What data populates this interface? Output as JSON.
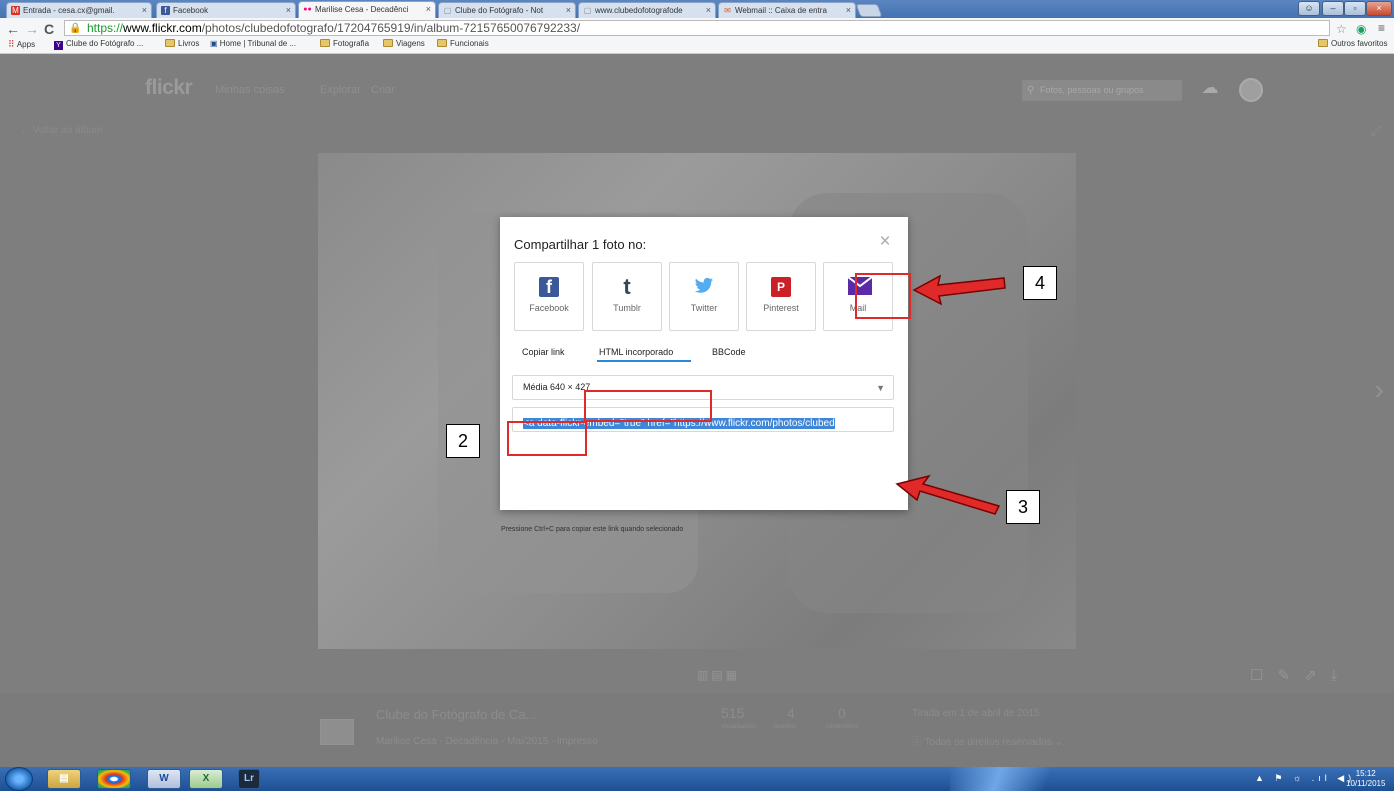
{
  "browser": {
    "tabs": [
      {
        "label": "Entrada - cesa.cx@gmail.",
        "icon": "M",
        "color": "#d93025"
      },
      {
        "label": "Facebook",
        "icon": "f",
        "color": "#3b5998"
      },
      {
        "label": "Marilise Cesa - Decadênci",
        "icon": "●●",
        "color": "#ff0084"
      },
      {
        "label": "Clube do Fotógrafo - Not",
        "icon": "▢",
        "color": "#888888"
      },
      {
        "label": "www.clubedofotografode",
        "icon": "▢",
        "color": "#888888"
      },
      {
        "label": "Webmail :: Caixa de entra",
        "icon": "✉",
        "color": "#d85a2a"
      }
    ],
    "url_scheme": "https://",
    "url_domain": "www.flickr.com",
    "url_path": "/photos/clubedofotografo/17204765919/in/album-72157650076792233/",
    "bookmarks": [
      "Apps",
      "Clube do Fotógrafo ...",
      "Livros",
      "Home | Tribunal de ...",
      "Fotografia",
      "Viagens",
      "Funcionais"
    ],
    "other_bookmarks": "Outros favoritos"
  },
  "flickr": {
    "logo": "flickr",
    "nav": [
      "Minhas coisas",
      "Explorar",
      "Criar"
    ],
    "search_placeholder": "Fotos, pessoas ou grupos",
    "back_label": "Voltar ao álbum"
  },
  "share_dialog": {
    "title": "Compartilhar 1 foto no:",
    "close": "×",
    "services": [
      {
        "label": "Facebook",
        "icon": "f",
        "color": "#3b5998"
      },
      {
        "label": "Tumblr",
        "icon": "t",
        "color": "#35465c"
      },
      {
        "label": "Twitter",
        "icon": "🐦",
        "color": "#55acee"
      },
      {
        "label": "Pinterest",
        "icon": "P",
        "color": "#cb2027"
      },
      {
        "label": "Mail",
        "icon": "✉",
        "color": "#6a1b9a"
      }
    ],
    "tabs": [
      "Copiar link",
      "HTML incorporado",
      "BBCode"
    ],
    "active_tab": "HTML incorporado",
    "size_value": "Média 640 × 427",
    "embed_code": "<a data-flickr-embed=\"true\"  href=\"https://www.flickr.com/photos/clubed",
    "hint": "Pressione Ctrl+C para copiar este link quando selecionado"
  },
  "annotations": {
    "label_2": "2",
    "label_3": "3",
    "label_4": "4",
    "color": "#e02a2a"
  },
  "info_bar": {
    "group_title": "Clube do Fotógrafo de Ca...",
    "photo_title": "Marilise Cesa - Decadência - Mai/2015 - impresso",
    "views": "515",
    "views_label": "visualizações",
    "faves": "4",
    "faves_label": "favoritos",
    "comments": "0",
    "comments_label": "comentários",
    "taken": "Tirada em 1 de abril de 2015",
    "rights": "Todos os direitos reservados"
  },
  "taskbar": {
    "time": "15:12",
    "date": "10/11/2015",
    "apps": [
      "ie",
      "explorer",
      "chrome",
      "word",
      "excel",
      "Lr"
    ]
  }
}
